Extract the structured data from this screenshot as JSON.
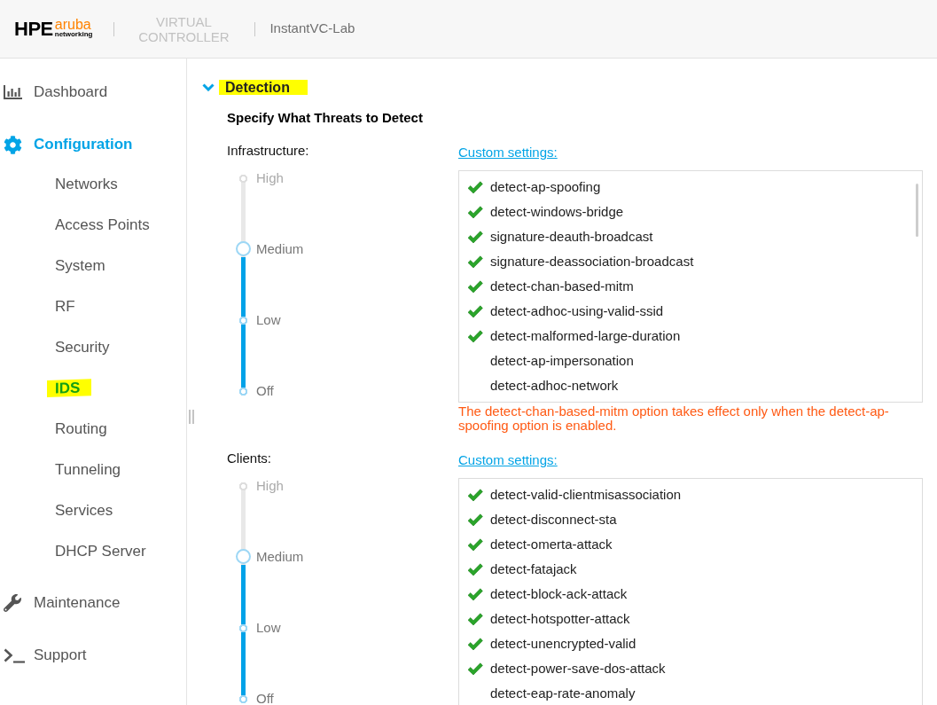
{
  "header": {
    "logo": {
      "brand": "HPE",
      "product": "aruba",
      "tagline": "networking"
    },
    "product_name": "VIRTUAL CONTROLLER",
    "controller_name": "InstantVC-Lab"
  },
  "sidebar": {
    "items": [
      {
        "label": "Dashboard",
        "selected": false
      },
      {
        "label": "Configuration",
        "selected": true,
        "children": [
          {
            "label": "Networks",
            "selected": false,
            "highlighted": false
          },
          {
            "label": "Access Points",
            "selected": false,
            "highlighted": false
          },
          {
            "label": "System",
            "selected": false,
            "highlighted": false
          },
          {
            "label": "RF",
            "selected": false,
            "highlighted": false
          },
          {
            "label": "Security",
            "selected": false,
            "highlighted": false
          },
          {
            "label": "IDS",
            "selected": true,
            "highlighted": true
          },
          {
            "label": "Routing",
            "selected": false,
            "highlighted": false
          },
          {
            "label": "Tunneling",
            "selected": false,
            "highlighted": false
          },
          {
            "label": "Services",
            "selected": false,
            "highlighted": false
          },
          {
            "label": "DHCP Server",
            "selected": false,
            "highlighted": false
          }
        ]
      },
      {
        "label": "Maintenance",
        "selected": false
      },
      {
        "label": "Support",
        "selected": false
      }
    ]
  },
  "section": {
    "title": "Detection",
    "expanded": true,
    "highlighted": true,
    "subtitle": "Specify What Threats to Detect",
    "groups": [
      {
        "label": "Infrastructure:",
        "slider": {
          "stops": [
            "High",
            "Medium",
            "Low",
            "Off"
          ],
          "level": 0.6667
        },
        "link": "Custom settings:",
        "scrollbar_shown": true,
        "options": [
          {
            "label": "detect-ap-spoofing",
            "checked": true
          },
          {
            "label": "detect-windows-bridge",
            "checked": true
          },
          {
            "label": "signature-deauth-broadcast",
            "checked": true
          },
          {
            "label": "signature-deassociation-broadcast",
            "checked": true
          },
          {
            "label": "detect-chan-based-mitm",
            "checked": true
          },
          {
            "label": "detect-adhoc-using-valid-ssid",
            "checked": true
          },
          {
            "label": "detect-malformed-large-duration",
            "checked": true
          },
          {
            "label": "detect-ap-impersonation",
            "checked": false
          },
          {
            "label": "detect-adhoc-network",
            "checked": false
          }
        ],
        "note": "The detect-chan-based-mitm option takes effect only when the detect-ap-spoofing option is enabled."
      },
      {
        "label": "Clients:",
        "slider": {
          "stops": [
            "High",
            "Medium",
            "Low",
            "Off"
          ],
          "level": 0.6667
        },
        "link": "Custom settings:",
        "scrollbar_shown": false,
        "options": [
          {
            "label": "detect-valid-clientmisassociation",
            "checked": true
          },
          {
            "label": "detect-disconnect-sta",
            "checked": true
          },
          {
            "label": "detect-omerta-attack",
            "checked": true
          },
          {
            "label": "detect-fatajack",
            "checked": true
          },
          {
            "label": "detect-block-ack-attack",
            "checked": true
          },
          {
            "label": "detect-hotspotter-attack",
            "checked": true
          },
          {
            "label": "detect-unencrypted-valid",
            "checked": true
          },
          {
            "label": "detect-power-save-dos-attack",
            "checked": true
          },
          {
            "label": "detect-eap-rate-anomaly",
            "checked": false
          }
        ]
      }
    ]
  }
}
